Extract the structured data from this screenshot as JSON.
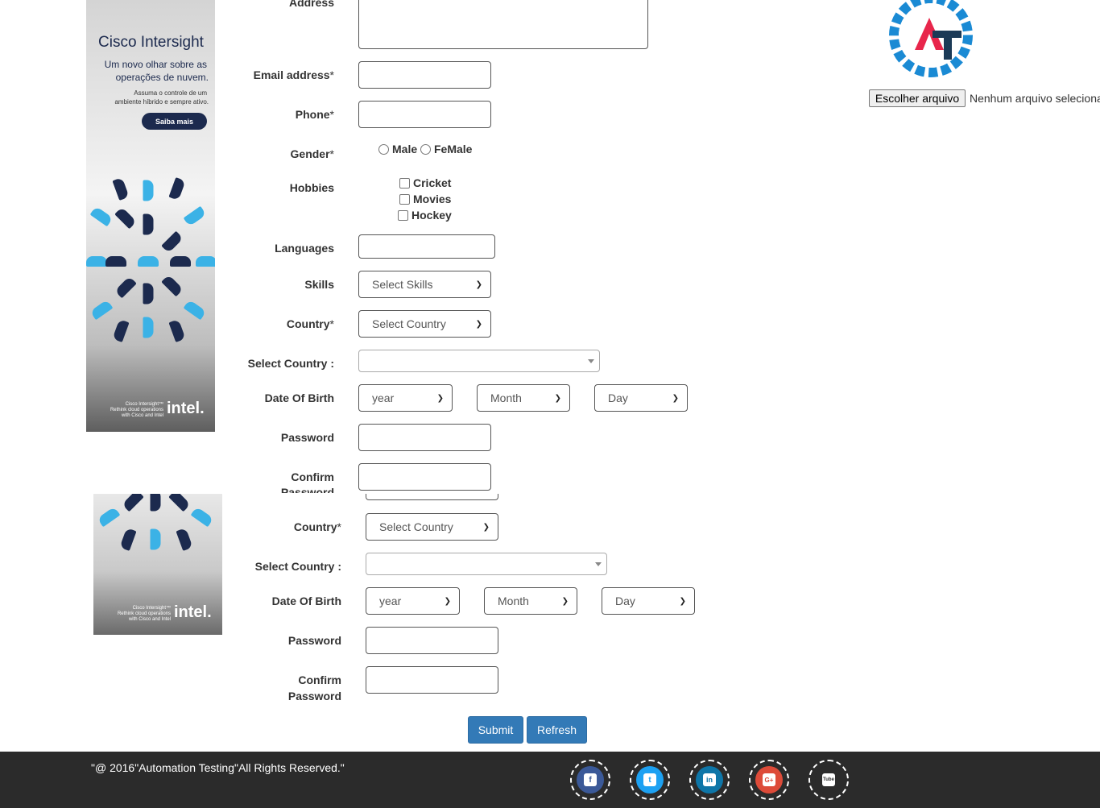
{
  "labels": {
    "address": "Address",
    "email": "Email address",
    "phone": "Phone",
    "gender": "Gender",
    "hobbies": "Hobbies",
    "languages": "Languages",
    "skills": "Skills",
    "country": "Country",
    "select_country": "Select Country :",
    "dob": "Date Of Birth",
    "password": "Password",
    "confirm": "Confirm",
    "confirm2": "Password",
    "required": "*"
  },
  "gender_options": [
    "Male",
    "FeMale"
  ],
  "hobbies": [
    "Cricket",
    "Movies",
    "Hockey"
  ],
  "selects": {
    "skills": "Select Skills",
    "country": "Select Country",
    "year": "year",
    "month": "Month",
    "day": "Day"
  },
  "buttons": {
    "submit": "Submit",
    "refresh": "Refresh"
  },
  "file": {
    "button": "Escolher arquivo",
    "status": "Nenhum arquivo selecionado"
  },
  "ad": {
    "title": "Cisco Intersight",
    "line1": "Um novo olhar sobre as",
    "line2": "operações de nuvem.",
    "line3": "Assuma o controle de um",
    "line4": "ambiente híbrido e sempre ativo.",
    "cta": "Saiba mais",
    "foot1": "Cisco Intersight™",
    "foot2": "Rethink cloud operations",
    "foot3": "with Cisco and Intel",
    "brand": "intel."
  },
  "footer": {
    "copyright": "\"@ 2016\"Automation Testing\"All Rights Reserved.\"",
    "social": [
      {
        "icon": "facebook-icon",
        "color": "#3b5998",
        "glyph": "f"
      },
      {
        "icon": "twitter-icon",
        "color": "#1da1f2",
        "glyph": "t"
      },
      {
        "icon": "linkedin-icon",
        "color": "#0e76a8",
        "glyph": "in"
      },
      {
        "icon": "google-plus-icon",
        "color": "#dd4b39",
        "glyph": "G+"
      },
      {
        "icon": "youtube-icon",
        "color": "#ffffff",
        "glyph": "Tube"
      }
    ]
  },
  "colors": {
    "primary": "#337ab7",
    "footer_bg": "#2b2b2b",
    "logo_blue": "#1a8ad4",
    "logo_red": "#e8264b",
    "logo_dark": "#1b3a57"
  }
}
